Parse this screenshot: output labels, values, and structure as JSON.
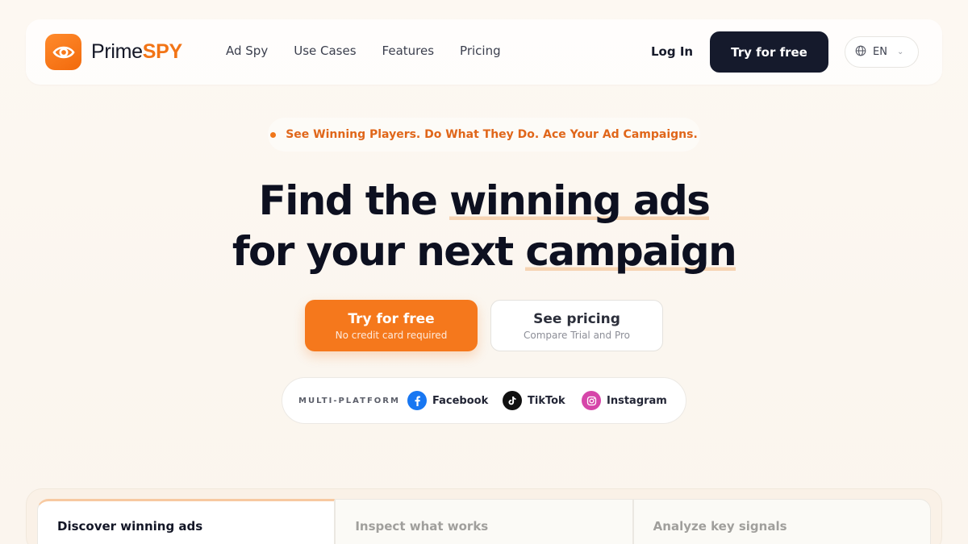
{
  "brand": {
    "name_prefix": "Prime",
    "name_accent": "SPY",
    "accent_color": "#f27416"
  },
  "nav": {
    "links": [
      "Ad Spy",
      "Use Cases",
      "Features",
      "Pricing"
    ],
    "login_label": "Log In",
    "cta_label": "Try for free",
    "language": "EN"
  },
  "hero": {
    "tagline": "See Winning Players. Do What They Do. Ace Your Ad Campaigns.",
    "title_line1_plain": "Find the ",
    "title_line1_highlight": "winning ads",
    "title_line2_plain": "for your next ",
    "title_line2_highlight": "campaign",
    "primary_cta": {
      "label": "Try for free",
      "sublabel": "No credit card required"
    },
    "secondary_cta": {
      "label": "See pricing",
      "sublabel": "Compare Trial and Pro"
    }
  },
  "platforms": {
    "label": "MULTI-PLATFORM",
    "items": [
      {
        "name": "Facebook",
        "icon": "facebook-icon",
        "color": "#1877f2"
      },
      {
        "name": "TikTok",
        "icon": "tiktok-icon",
        "color": "#111111"
      },
      {
        "name": "Instagram",
        "icon": "instagram-icon",
        "color": "#d646a9"
      }
    ]
  },
  "feature_tabs": [
    "Discover winning ads",
    "Inspect what works",
    "Analyze key signals"
  ]
}
